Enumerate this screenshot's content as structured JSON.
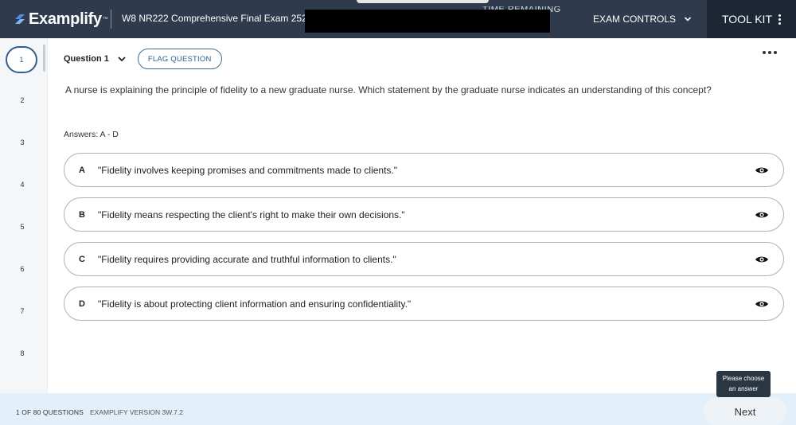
{
  "header": {
    "brand": "Examplify",
    "exam_title": "W8 NR222 Comprehensive Final Exam 2526",
    "time_remaining_label": "TIME REMAINING",
    "exam_controls_label": "EXAM CONTROLS",
    "toolkit_label": "TOOL KIT"
  },
  "question_nav": {
    "current": "1",
    "items": [
      "2",
      "3",
      "4",
      "5",
      "6",
      "7",
      "8"
    ]
  },
  "question": {
    "label": "Question 1",
    "flag_label": "FLAG QUESTION",
    "stem": "A nurse is explaining the principle of fidelity to a new graduate nurse. Which statement by the graduate nurse indicates an understanding of this concept?",
    "answers_label": "Answers: A - D",
    "choices": [
      {
        "letter": "A",
        "text": "\"Fidelity involves keeping promises and commitments made to clients.\""
      },
      {
        "letter": "B",
        "text": "\"Fidelity means respecting the client's right to make their own decisions.\""
      },
      {
        "letter": "C",
        "text": "\"Fidelity requires providing accurate and truthful information to clients.\""
      },
      {
        "letter": "D",
        "text": "\"Fidelity is about protecting client information and ensuring confidentiality.\""
      }
    ]
  },
  "footer": {
    "progress": "1 OF 80 QUESTIONS",
    "version": "EXAMPLIFY VERSION 3W.7.2",
    "next_label": "Next",
    "tooltip_line1": "Please choose",
    "tooltip_line2": "an answer"
  },
  "colors": {
    "topbar": "#2f3b4c",
    "toolkit_bg": "#1c2634",
    "accent": "#2f5f8f",
    "footer_bg": "#e4f0f9"
  }
}
